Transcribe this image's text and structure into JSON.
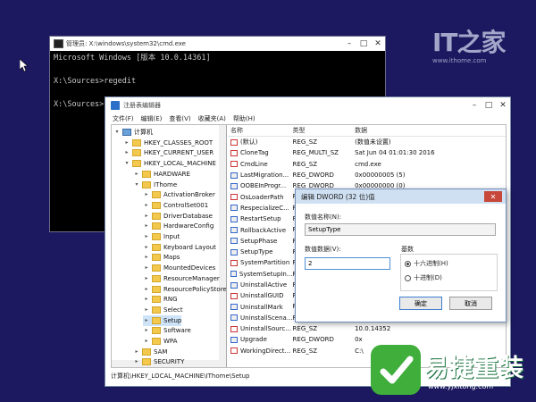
{
  "watermark": {
    "logo": "IT之家",
    "url": "www.ithome.com"
  },
  "cmd": {
    "title": "管理员: X:\\windows\\system32\\cmd.exe",
    "lines": [
      "Microsoft Windows [版本 10.0.14361]",
      "",
      "X:\\Sources>regedit",
      "",
      "X:\\Sources>"
    ]
  },
  "regedit": {
    "title": "注册表编辑器",
    "menu": [
      "文件(F)",
      "编辑(E)",
      "查看(V)",
      "收藏夹(A)",
      "帮助(H)"
    ],
    "tree": [
      {
        "label": "计算机",
        "level": 0,
        "icon": "computer-icon",
        "expanded": true
      },
      {
        "label": "HKEY_CLASSES_ROOT",
        "level": 1
      },
      {
        "label": "HKEY_CURRENT_USER",
        "level": 1
      },
      {
        "label": "HKEY_LOCAL_MACHINE",
        "level": 1,
        "expanded": true
      },
      {
        "label": "HARDWARE",
        "level": 2
      },
      {
        "label": "IThome",
        "level": 2,
        "expanded": true
      },
      {
        "label": "ActivationBroker",
        "level": 3
      },
      {
        "label": "ControlSet001",
        "level": 3
      },
      {
        "label": "DriverDatabase",
        "level": 3
      },
      {
        "label": "HardwareConfig",
        "level": 3
      },
      {
        "label": "Input",
        "level": 3
      },
      {
        "label": "Keyboard Layout",
        "level": 3
      },
      {
        "label": "Maps",
        "level": 3
      },
      {
        "label": "MountedDevices",
        "level": 3
      },
      {
        "label": "ResourceManager",
        "level": 3
      },
      {
        "label": "ResourcePolicyStore",
        "level": 3
      },
      {
        "label": "RNG",
        "level": 3
      },
      {
        "label": "Select",
        "level": 3
      },
      {
        "label": "Setup",
        "level": 3,
        "selected": true
      },
      {
        "label": "Software",
        "level": 3
      },
      {
        "label": "WPA",
        "level": 3
      },
      {
        "label": "SAM",
        "level": 2
      },
      {
        "label": "SECURITY",
        "level": 2
      }
    ],
    "columns": [
      "名称",
      "类型",
      "数据"
    ],
    "values": [
      {
        "name": "(默认)",
        "type": "REG_SZ",
        "data": "(数值未设置)",
        "kind": "sz"
      },
      {
        "name": "CloneTag",
        "type": "REG_MULTI_SZ",
        "data": "Sat Jun 04 01:01:30 2016",
        "kind": "sz"
      },
      {
        "name": "CmdLine",
        "type": "REG_SZ",
        "data": "cmd.exe",
        "kind": "sz"
      },
      {
        "name": "LastMigration...",
        "type": "REG_DWORD",
        "data": "0x00000005 (5)",
        "kind": "dw"
      },
      {
        "name": "OOBEInProgr...",
        "type": "REG_DWORD",
        "data": "0x00000000 (0)",
        "kind": "dw"
      },
      {
        "name": "OsLoaderPath",
        "type": "REG_SZ",
        "data": "",
        "kind": "sz"
      },
      {
        "name": "RespecializeC...",
        "type": "REG_DWORD",
        "data": "",
        "kind": "dw"
      },
      {
        "name": "RestartSetup",
        "type": "REG_DWORD",
        "data": "",
        "kind": "dw"
      },
      {
        "name": "RollbackActive",
        "type": "REG_DWORD",
        "data": "",
        "kind": "dw"
      },
      {
        "name": "SetupPhase",
        "type": "REG_DWORD",
        "data": "",
        "kind": "dw"
      },
      {
        "name": "SetupType",
        "type": "REG_DWORD",
        "data": "",
        "kind": "dw"
      },
      {
        "name": "SystemPartition",
        "type": "REG_SZ",
        "data": "",
        "kind": "sz"
      },
      {
        "name": "SystemSetupIn...",
        "type": "REG_DWORD",
        "data": "",
        "kind": "dw"
      },
      {
        "name": "UninstallActive",
        "type": "REG_DWORD",
        "data": "",
        "kind": "dw"
      },
      {
        "name": "UninstallGUID",
        "type": "REG_SZ",
        "data": "",
        "kind": "sz"
      },
      {
        "name": "UninstallMark",
        "type": "REG_DWORD",
        "data": "",
        "kind": "dw"
      },
      {
        "name": "UninstallScena...",
        "type": "REG_DWORD",
        "data": "",
        "kind": "dw"
      },
      {
        "name": "UninstallSourc...",
        "type": "REG_SZ",
        "data": "10.0.14352",
        "kind": "sz"
      },
      {
        "name": "Upgrade",
        "type": "REG_DWORD",
        "data": "0x",
        "kind": "dw"
      },
      {
        "name": "WorkingDirect...",
        "type": "REG_SZ",
        "data": "C:\\",
        "kind": "sz"
      }
    ],
    "status": "计算机\\HKEY_LOCAL_MACHINE\\IThome\\Setup"
  },
  "dialog": {
    "title": "编辑 DWORD (32 位)值",
    "name_label": "数值名称(N):",
    "name_value": "SetupType",
    "data_label": "数值数据(V):",
    "data_value": "2",
    "base_label": "基数",
    "hex_label": "十六进制(H)",
    "dec_label": "十进制(D)",
    "ok": "确定",
    "cancel": "取消"
  },
  "brand": {
    "title": "易捷重装",
    "url": "www.yjxitong.com"
  }
}
